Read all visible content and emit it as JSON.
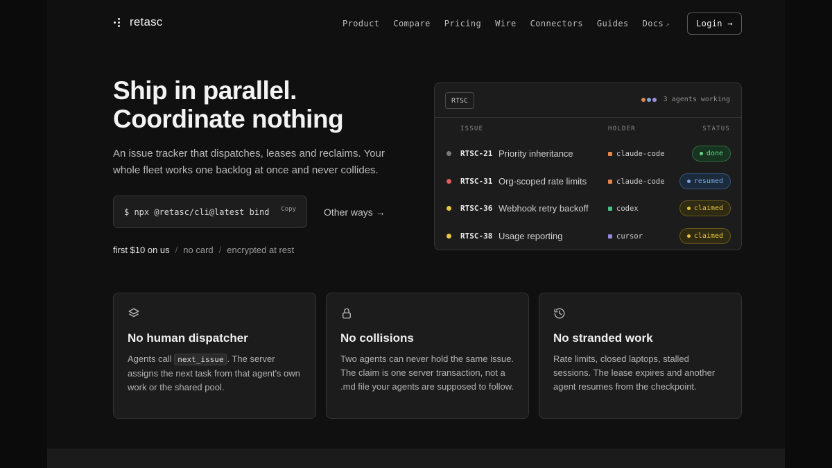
{
  "brand": {
    "name": "retasc"
  },
  "nav": {
    "links": [
      "Product",
      "Compare",
      "Pricing",
      "Wire",
      "Connectors",
      "Guides",
      "Docs"
    ],
    "docs_ext_icon": "external-link-icon",
    "login_label": "Login →"
  },
  "hero": {
    "title_line1": "Ship in parallel.",
    "title_line2": "Coordinate nothing",
    "subtitle": "An issue tracker that dispatches, leases and reclaims. Your whole fleet works one backlog at once and never collides.",
    "command": "$ npx @retasc/cli@latest bind",
    "copy_label": "Copy",
    "other_ways": "Other ways →",
    "perks": [
      "first $10 on us",
      "no card",
      "encrypted at rest"
    ],
    "perk_separator": "/"
  },
  "panel": {
    "project_tag": "RTSC",
    "agents_text": "3 agents working",
    "agent_colors": [
      "#e2884a",
      "#7ea6e0",
      "#a58be0"
    ],
    "headers": {
      "issue": "ISSUE",
      "holder": "HOLDER",
      "status": "STATUS"
    },
    "rows": [
      {
        "id": "RTSC-21",
        "title": "Priority inheritance",
        "holder": "claude-code",
        "status": "done",
        "dot": "#7a7a7a",
        "holder_color": "#e2884a"
      },
      {
        "id": "RTSC-31",
        "title": "Org-scoped rate limits",
        "holder": "claude-code",
        "status": "resumed",
        "dot": "#e25c5c",
        "holder_color": "#e2884a"
      },
      {
        "id": "RTSC-36",
        "title": "Webhook retry backoff",
        "holder": "codex",
        "status": "claimed",
        "dot": "#e6c745",
        "holder_color": "#4fbf8a"
      },
      {
        "id": "RTSC-38",
        "title": "Usage reporting",
        "holder": "cursor",
        "status": "claimed",
        "dot": "#e6c745",
        "holder_color": "#9b86e0"
      }
    ]
  },
  "features": [
    {
      "icon": "layers-icon",
      "title": "No human dispatcher",
      "body_pre": "Agents call",
      "code": "next_issue",
      "body_post": ". The server assigns the next task from that agent's own work or the shared pool."
    },
    {
      "icon": "lock-icon",
      "title": "No collisions",
      "body": "Two agents can never hold the same issue. The claim is one server transaction, not a .md file your agents are supposed to follow."
    },
    {
      "icon": "history-icon",
      "title": "No stranded work",
      "body": "Rate limits, closed laptops, stalled sessions. The lease expires and another agent resumes from the checkpoint."
    }
  ]
}
